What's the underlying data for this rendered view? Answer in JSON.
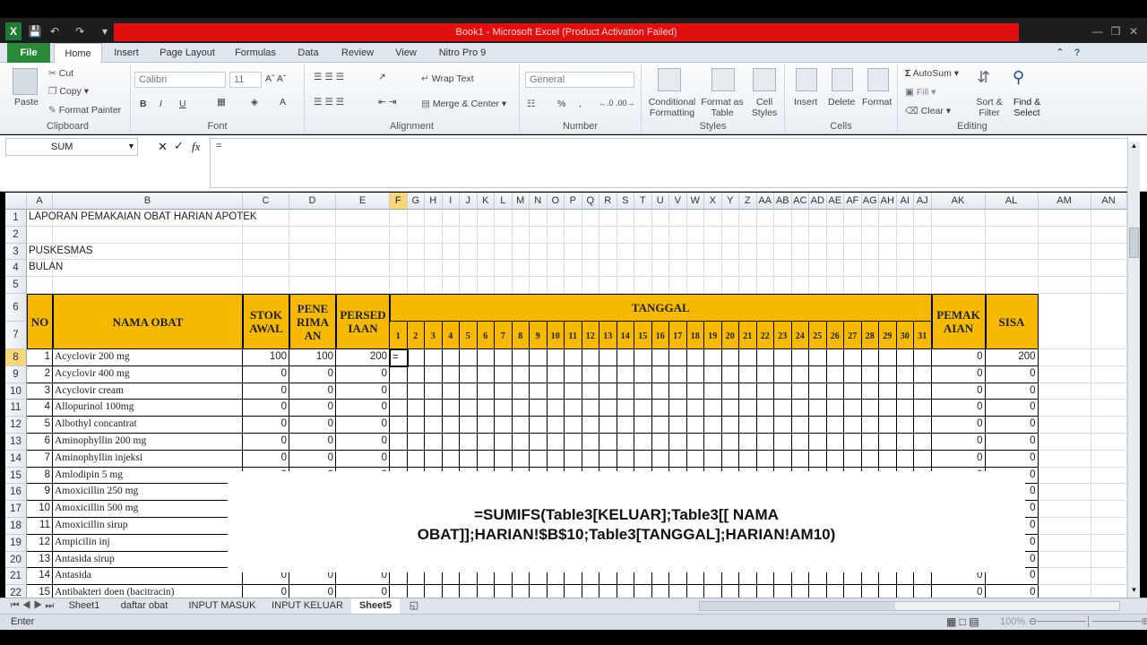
{
  "window": {
    "title": "Book1 - Microsoft Excel (Product Activation Failed)"
  },
  "tabs": [
    "File",
    "Home",
    "Insert",
    "Page Layout",
    "Formulas",
    "Data",
    "Review",
    "View",
    "Nitro Pro 9"
  ],
  "clipboard": {
    "paste": "Paste",
    "cut": "Cut",
    "copy": "Copy",
    "format_painter": "Format Painter",
    "label": "Clipboard"
  },
  "font": {
    "name": "Calibri",
    "size": "11",
    "label": "Font",
    "bold": "B",
    "italic": "I",
    "underline": "U"
  },
  "alignment": {
    "wrap": "Wrap Text",
    "merge": "Merge & Center",
    "label": "Alignment"
  },
  "number": {
    "format": "General",
    "label": "Number",
    "percent": "%",
    "comma": ","
  },
  "styles": {
    "conditional": "Conditional Formatting",
    "format_table": "Format as Table",
    "cell_styles": "Cell Styles",
    "label": "Styles"
  },
  "cells": {
    "insert": "Insert",
    "delete": "Delete",
    "format": "Format",
    "label": "Cells"
  },
  "editing": {
    "autosum": "AutoSum",
    "fill": "Fill",
    "clear": "Clear",
    "sort": "Sort & Filter",
    "find": "Find & Select",
    "label": "Editing"
  },
  "formula_bar": {
    "name_box": "SUM",
    "content": "=",
    "fx": "fx"
  },
  "columns": [
    "A",
    "B",
    "C",
    "D",
    "E",
    "F",
    "G",
    "H",
    "I",
    "J",
    "K",
    "L",
    "M",
    "N",
    "O",
    "P",
    "Q",
    "R",
    "S",
    "T",
    "U",
    "V",
    "W",
    "X",
    "Y",
    "Z",
    "AA",
    "AB",
    "AC",
    "AD",
    "AE",
    "AF",
    "AG",
    "AH",
    "AI",
    "AJ",
    "AK",
    "AL",
    "AM",
    "AN"
  ],
  "rows": [
    "1",
    "2",
    "3",
    "4",
    "5",
    "6",
    "7",
    "8",
    "9",
    "10",
    "11",
    "12",
    "13",
    "14",
    "15",
    "16",
    "17",
    "18",
    "19",
    "20",
    "21",
    "22"
  ],
  "report": {
    "title": "LAPORAN PEMAKAIAN OBAT HARIAN APOTEK",
    "puskesmas": "PUSKESMAS",
    "bulan": "BULAN",
    "h_no": "NO",
    "h_nama": "NAMA OBAT",
    "h_stok": "STOK AWAL",
    "h_penerimaan": "PENE RIMA AN",
    "h_persediaan": "PERSED IAAN",
    "h_tanggal": "TANGGAL",
    "h_pemakaian": "PEMAK AIAN",
    "h_sisa": "SISA",
    "days": [
      "1",
      "2",
      "3",
      "4",
      "5",
      "6",
      "7",
      "8",
      "9",
      "10",
      "11",
      "12",
      "13",
      "14",
      "15",
      "16",
      "17",
      "18",
      "19",
      "20",
      "21",
      "22",
      "23",
      "24",
      "25",
      "26",
      "27",
      "28",
      "29",
      "30",
      "31"
    ],
    "items": [
      {
        "no": "1",
        "nama": "Acyclovir 200 mg",
        "stok": "100",
        "terima": "100",
        "sedia": "200",
        "pakai": "0",
        "sisa": "200"
      },
      {
        "no": "2",
        "nama": "Acyclovir 400 mg",
        "stok": "0",
        "terima": "0",
        "sedia": "0",
        "pakai": "0",
        "sisa": "0"
      },
      {
        "no": "3",
        "nama": "Acyclovir cream",
        "stok": "0",
        "terima": "0",
        "sedia": "0",
        "pakai": "0",
        "sisa": "0"
      },
      {
        "no": "4",
        "nama": "Allopurinol 100mg",
        "stok": "0",
        "terima": "0",
        "sedia": "0",
        "pakai": "0",
        "sisa": "0"
      },
      {
        "no": "5",
        "nama": "Albothyl concantrat",
        "stok": "0",
        "terima": "0",
        "sedia": "0",
        "pakai": "0",
        "sisa": "0"
      },
      {
        "no": "6",
        "nama": "Aminophyllin 200 mg",
        "stok": "0",
        "terima": "0",
        "sedia": "0",
        "pakai": "0",
        "sisa": "0"
      },
      {
        "no": "7",
        "nama": "Aminophyllin injeksi",
        "stok": "0",
        "terima": "0",
        "sedia": "0",
        "pakai": "0",
        "sisa": "0"
      },
      {
        "no": "8",
        "nama": "Amlodipin 5 mg",
        "stok": "0",
        "terima": "0",
        "sedia": "0",
        "pakai": "0",
        "sisa": "0"
      },
      {
        "no": "9",
        "nama": "Amoxicillin 250 mg",
        "stok": "",
        "terima": "",
        "sedia": "",
        "pakai": "",
        "sisa": "0"
      },
      {
        "no": "10",
        "nama": "Amoxicillin 500 mg",
        "stok": "",
        "terima": "",
        "sedia": "",
        "pakai": "",
        "sisa": "0"
      },
      {
        "no": "11",
        "nama": "Amoxicillin sirup",
        "stok": "",
        "terima": "",
        "sedia": "",
        "pakai": "",
        "sisa": "0"
      },
      {
        "no": "12",
        "nama": "Ampicilin inj",
        "stok": "",
        "terima": "",
        "sedia": "",
        "pakai": "",
        "sisa": "0"
      },
      {
        "no": "13",
        "nama": "Antasida sirup",
        "stok": "",
        "terima": "",
        "sedia": "",
        "pakai": "",
        "sisa": "0"
      },
      {
        "no": "14",
        "nama": "Antasida",
        "stok": "0",
        "terima": "0",
        "sedia": "0",
        "pakai": "0",
        "sisa": "0"
      },
      {
        "no": "15",
        "nama": "Antibakteri doen (bacitracin)",
        "stok": "0",
        "terima": "0",
        "sedia": "0",
        "pakai": "0",
        "sisa": "0"
      }
    ],
    "active_cell_entry": "="
  },
  "overlay_formula": {
    "line1": "=SUMIFS(Table3[KELUAR];Table3[[ NAMA",
    "line2": "OBAT]];HARIAN!$B$10;Table3[TANGGAL];HARIAN!AM10)"
  },
  "sheets": [
    "Sheet1",
    "daftar obat",
    "INPUT MASUK",
    "INPUT KELUAR",
    "Sheet5"
  ],
  "active_sheet": "Sheet5",
  "status": {
    "mode": "Enter",
    "zoom": "100%"
  },
  "colors": {
    "header_fill": "#f7b900",
    "file_tab": "#2a8a3a",
    "title_bar": "#e01010",
    "selected_header": "#f8d67a"
  }
}
